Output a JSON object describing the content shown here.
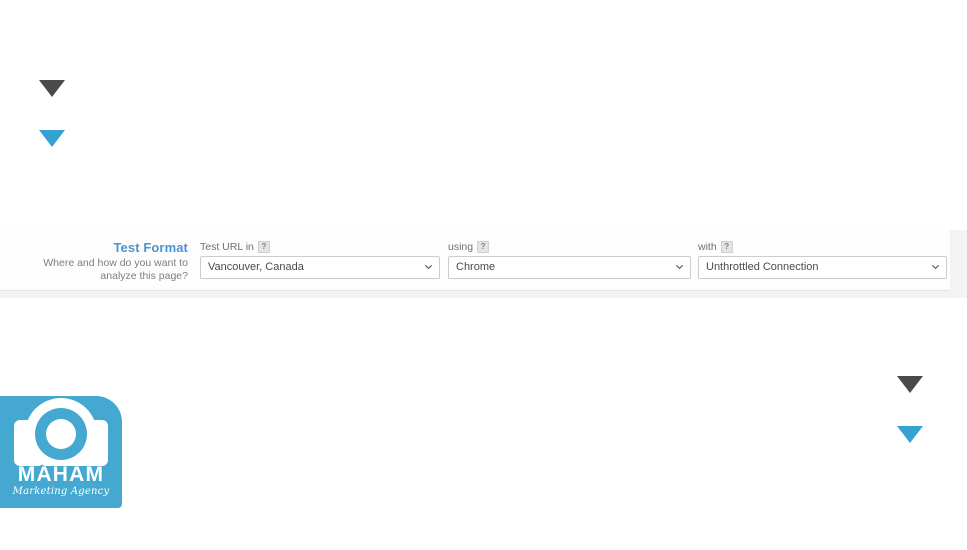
{
  "test_format": {
    "title": "Test Format",
    "subtitle_line1": "Where and how do you want to",
    "subtitle_line2": "analyze this page?",
    "title_color": "#4a93d1",
    "fields": [
      {
        "label": "Test URL in",
        "help": "?",
        "value": "Vancouver, Canada",
        "icon": "chevron-down-icon"
      },
      {
        "label": "using",
        "help": "?",
        "value": "Chrome",
        "icon": "chevron-down-icon"
      },
      {
        "label": "with",
        "help": "?",
        "value": "Unthrottled Connection",
        "icon": "chevron-down-icon"
      }
    ]
  },
  "markers": [
    {
      "name": "triangle-top-left-dark",
      "color": "#4a4a4a"
    },
    {
      "name": "triangle-top-left-blue",
      "color": "#34a3d4"
    },
    {
      "name": "triangle-bottom-right-dark",
      "color": "#4a4a4a"
    },
    {
      "name": "triangle-bottom-right-blue",
      "color": "#34a3d4"
    }
  ],
  "logo": {
    "name": "MAHAM",
    "tagline": "Marketing Agency",
    "brand_color": "#44a8d0",
    "mark_icon": "camera-bubble-icon"
  }
}
